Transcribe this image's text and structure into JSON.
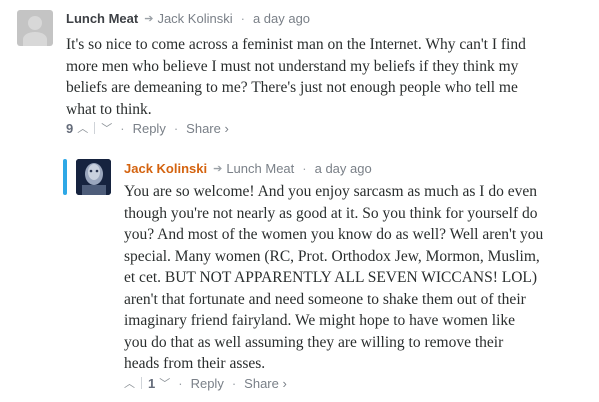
{
  "comments": [
    {
      "author": "Lunch Meat",
      "reply_to": "Jack Kolinski",
      "time": "a day ago",
      "lines": [
        "It's so nice to come across a feminist man on the Internet. Why can't I find",
        "more men who believe I must not understand my beliefs if they think my",
        "beliefs are demeaning to me? There's just not enough people who tell me",
        "what to think."
      ],
      "upvotes": "9",
      "reply_label": "Reply",
      "share_label": "Share ›"
    },
    {
      "author": "Jack Kolinski",
      "reply_to": "Lunch Meat",
      "time": "a day ago",
      "lines": [
        "You are so welcome! And you enjoy sarcasm as much as I do even",
        "though you're not nearly as good at it. So you think for yourself do",
        "you? And most of the women you know do as well? Well aren't you",
        "special. Many women (RC, Prot. Orthodox Jew, Mormon, Muslim,",
        "et cet. BUT NOT APPARENTLY ALL SEVEN WICCANS! LOL)",
        "aren't that fortunate and need someone to shake them out of their",
        "imaginary friend fairyland. We might hope to have women like",
        "you do that as well assuming they are willing to remove their",
        "heads from their asses."
      ],
      "downvotes": "1",
      "reply_label": "Reply",
      "share_label": "Share ›"
    }
  ],
  "icons": {
    "reply_arrow": "➔",
    "upvote": "︿",
    "downvote": "﹀"
  },
  "colors": {
    "author_highlight": "#d4630f",
    "accent_bar": "#2ea8e6"
  }
}
